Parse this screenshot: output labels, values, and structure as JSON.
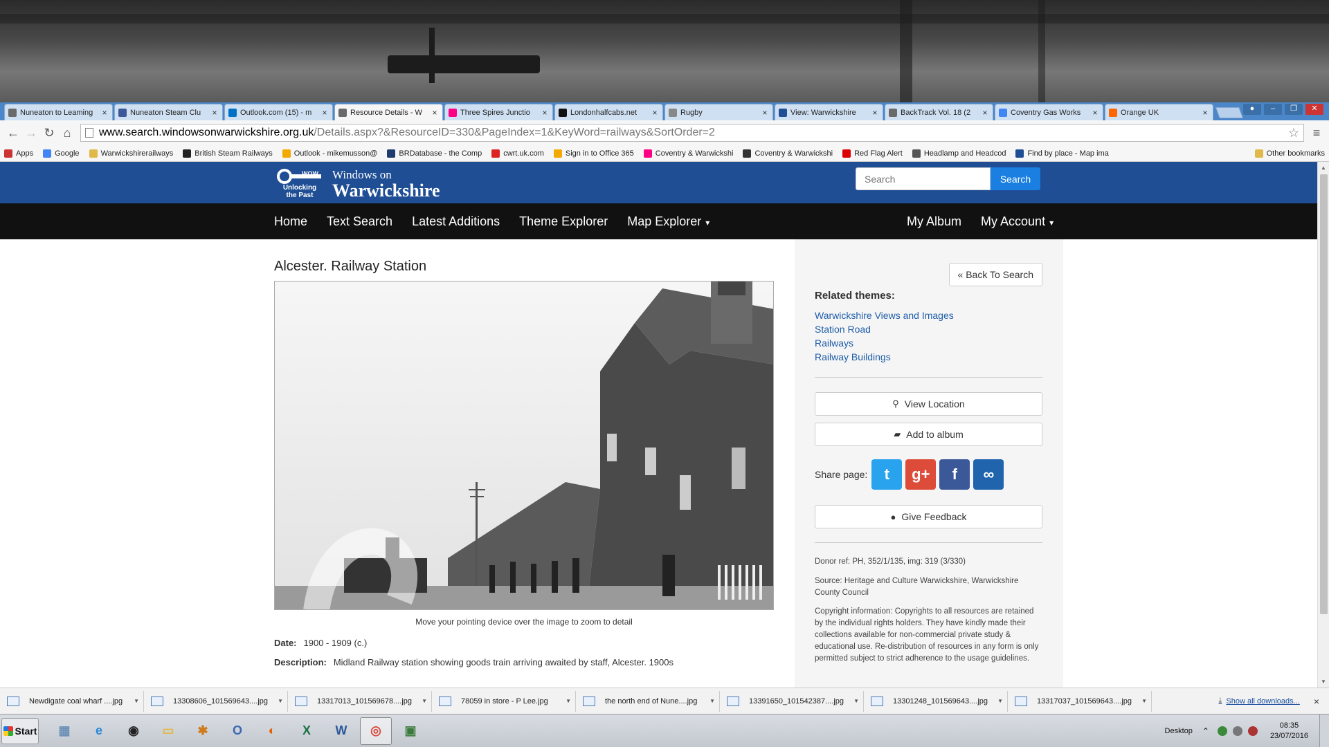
{
  "browser": {
    "tabs": [
      {
        "title": "Nuneaton to Leaming",
        "icon": "page-icon",
        "color": "#6a6a6a"
      },
      {
        "title": "Nuneaton Steam Clu",
        "icon": "facebook-icon",
        "color": "#3b5998"
      },
      {
        "title": "Outlook.com (15) - m",
        "icon": "outlook-icon",
        "color": "#0072c6"
      },
      {
        "title": "Resource Details - W",
        "icon": "page-icon",
        "color": "#6a6a6a",
        "active": true
      },
      {
        "title": "Three Spires Junctio",
        "icon": "flickr-icon",
        "color": "#ff0084"
      },
      {
        "title": "Londonhalfcabs.net",
        "icon": "site-icon",
        "color": "#111111"
      },
      {
        "title": "Rugby",
        "icon": "gear-icon",
        "color": "#888888"
      },
      {
        "title": "View: Warwickshire",
        "icon": "bird-icon",
        "color": "#1f4e95"
      },
      {
        "title": "BackTrack Vol. 18 (2",
        "icon": "page-icon",
        "color": "#6a6a6a"
      },
      {
        "title": "Coventry Gas Works",
        "icon": "google-icon",
        "color": "#4285f4"
      },
      {
        "title": "Orange UK",
        "icon": "orange-icon",
        "color": "#ff6600"
      }
    ],
    "close_glyph": "×",
    "url_host": "www.search.windowsonwarwickshire.org.uk",
    "url_path": "/Details.aspx?&ResourceID=330&PageIndex=1&KeyWord=railways&SortOrder=2",
    "bookmarks": [
      {
        "label": "Apps",
        "color": "#c33"
      },
      {
        "label": "Google",
        "color": "#4285f4"
      },
      {
        "label": "Warwickshirerailways",
        "color": "#e0b94a"
      },
      {
        "label": "British Steam Railways",
        "color": "#222"
      },
      {
        "label": "Outlook - mikemusson@",
        "color": "#f2a900"
      },
      {
        "label": "BRDatabase - the Comp",
        "color": "#1f3c6e"
      },
      {
        "label": "cwrt.uk.com",
        "color": "#d22"
      },
      {
        "label": "Sign in to Office 365",
        "color": "#f2a900"
      },
      {
        "label": "Coventry & Warwickshi",
        "color": "#ff0084"
      },
      {
        "label": "Coventry & Warwickshi",
        "color": "#333"
      },
      {
        "label": "Red Flag Alert",
        "color": "#d00"
      },
      {
        "label": "Headlamp and Headcod",
        "color": "#555"
      },
      {
        "label": "Find by place - Map ima",
        "color": "#1f4e95"
      }
    ],
    "other_bookmarks": "Other bookmarks"
  },
  "site": {
    "logo_wow": "WOW",
    "logo_tagline": "Unlocking the Past",
    "logo_line1": "Windows on",
    "logo_line2": "Warwickshire",
    "search_placeholder": "Search",
    "search_button": "Search",
    "nav_left": [
      "Home",
      "Text Search",
      "Latest Additions",
      "Theme Explorer",
      "Map Explorer"
    ],
    "nav_right": [
      "My Album",
      "My Account"
    ],
    "caret": "▾"
  },
  "resource": {
    "title": "Alcester. Railway Station",
    "zoom_hint": "Move your pointing device over the image to zoom to detail",
    "date_label": "Date:",
    "date_value": "1900 - 1909 (c.)",
    "desc_label": "Description:",
    "desc_value": "Midland Railway station showing goods train arriving awaited by staff, Alcester. 1900s"
  },
  "sidebar": {
    "back_button": "« Back To Search",
    "related_heading": "Related themes:",
    "related": [
      "Warwickshire Views and Images",
      "Station Road",
      "Railways",
      "Railway Buildings"
    ],
    "view_location": "View Location",
    "add_album": "Add to album",
    "share_label": "Share page:",
    "share_buttons": [
      {
        "name": "twitter",
        "glyph": "t",
        "color": "#2aa3ef"
      },
      {
        "name": "google-plus",
        "glyph": "g+",
        "color": "#dd4b39"
      },
      {
        "name": "facebook",
        "glyph": "f",
        "color": "#3b5998"
      },
      {
        "name": "link",
        "glyph": "∞",
        "color": "#1f64ad"
      }
    ],
    "feedback": "Give Feedback",
    "donor_ref": "Donor ref:  PH, 352/1/135, img: 319 (3/330)",
    "source": "Source:  Heritage and Culture Warwickshire, Warwickshire County Council",
    "copyright": "Copyright information: Copyrights to all resources are retained by the individual rights holders. They have kindly made their collections available for non-commercial private study & educational use. Re-distribution of resources in any form is only permitted subject to strict adherence to the usage guidelines."
  },
  "downloads": {
    "items": [
      "Newdigate coal wharf ....jpg",
      "13308606_101569643....jpg",
      "13317013_101569678....jpg",
      "78059 in store - P Lee.jpg",
      "the north end of Nune....jpg",
      "13391650_101542387....jpg",
      "13301248_101569643....jpg",
      "13317037_101569643....jpg"
    ],
    "show_all": "Show all downloads...",
    "close": "×"
  },
  "taskbar": {
    "start": "Start",
    "apps": [
      {
        "name": "calculator",
        "glyph": "▦",
        "color": "#6b8fb8"
      },
      {
        "name": "internet-explorer",
        "glyph": "e",
        "color": "#2a8ad8"
      },
      {
        "name": "eye-app",
        "glyph": "◉",
        "color": "#222"
      },
      {
        "name": "folder",
        "glyph": "▭",
        "color": "#e0b94a"
      },
      {
        "name": "tiger-app",
        "glyph": "✱",
        "color": "#d07a1a"
      },
      {
        "name": "outlook",
        "glyph": "O",
        "color": "#3a68b0"
      },
      {
        "name": "firefox",
        "glyph": "◐",
        "color": "#e66000"
      },
      {
        "name": "excel",
        "glyph": "X",
        "color": "#1e7145"
      },
      {
        "name": "word",
        "glyph": "W",
        "color": "#2b579a"
      },
      {
        "name": "chrome",
        "glyph": "◎",
        "color": "#db4437",
        "active": true
      },
      {
        "name": "usb-app",
        "glyph": "▣",
        "color": "#3a7a3a"
      }
    ],
    "desktop": "Desktop",
    "time": "08:35",
    "date": "23/07/2016"
  }
}
